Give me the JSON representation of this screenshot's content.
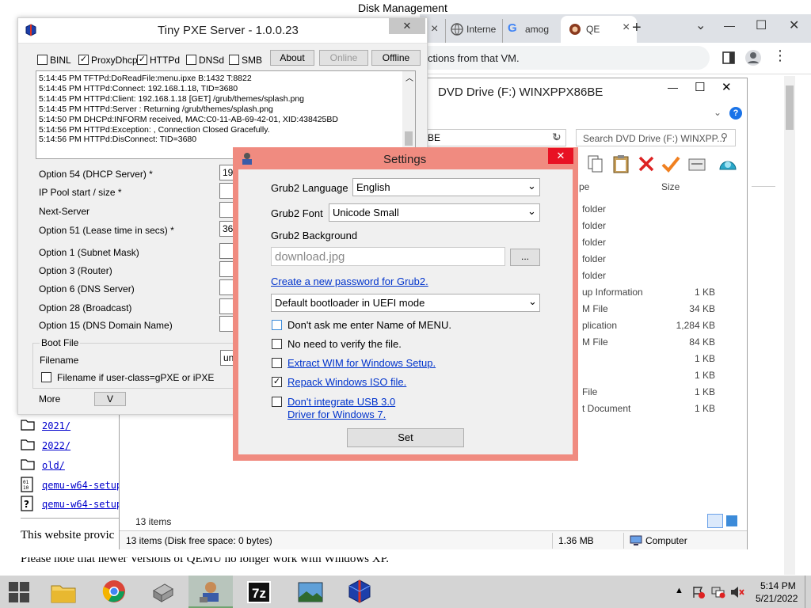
{
  "bg_title": "Disk Management",
  "chrome": {
    "tabs": [
      {
        "label": "Interne",
        "icon": "globe-icon"
      },
      {
        "label": "amog",
        "icon": "google-icon"
      },
      {
        "label": "QE",
        "icon": "qemu-icon"
      }
    ],
    "close_glyph": "×",
    "new_tab_glyph": "+",
    "menu_glyph": "⌄",
    "address_fragment": "ctions from that VM.",
    "min_glyph": "—",
    "max_glyph": "☐",
    "win_close_glyph": "✕"
  },
  "explorer": {
    "title": "DVD Drive (F:) WINXPPX86BE",
    "path_fragment": "BE",
    "search_placeholder": "Search DVD Drive (F:) WINXPP...",
    "col_type": "pe",
    "col_size": "Size",
    "rows": [
      {
        "type": "folder",
        "size": ""
      },
      {
        "type": "folder",
        "size": ""
      },
      {
        "type": "folder",
        "size": ""
      },
      {
        "type": "folder",
        "size": ""
      },
      {
        "type": "folder",
        "size": ""
      },
      {
        "type": "up Information",
        "size": "1 KB"
      },
      {
        "type": "M File",
        "size": "34 KB"
      },
      {
        "type": "plication",
        "size": "1,284 KB"
      },
      {
        "type": "M File",
        "size": "84 KB"
      },
      {
        "type": "",
        "size": "1 KB"
      },
      {
        "type": "",
        "size": "1 KB"
      },
      {
        "type": "File",
        "size": "1 KB"
      },
      {
        "type": "t Document",
        "size": "1 KB"
      }
    ],
    "items_count": "13 items",
    "status_text": "13 items (Disk free space: 0 bytes)",
    "status_size": "1.36 MB",
    "status_location": "Computer"
  },
  "web": {
    "listing": [
      {
        "name": "2021/",
        "icon": "folder-icon"
      },
      {
        "name": "2022/",
        "icon": "folder-icon"
      },
      {
        "name": "old/",
        "icon": "folder-icon"
      },
      {
        "name": "qemu-w64-setup",
        "icon": "binary-file-icon"
      },
      {
        "name": "qemu-w64-setup",
        "icon": "unknown-file-icon"
      }
    ],
    "line1": "This website provic",
    "line2": "Please note that newer Versions of QEMU no longer work with Windows XP."
  },
  "pxe": {
    "title": "Tiny PXE Server - 1.0.0.23",
    "options": [
      {
        "label": "BINL",
        "checked": false
      },
      {
        "label": "ProxyDhcp",
        "checked": true
      },
      {
        "label": "HTTPd",
        "checked": true
      },
      {
        "label": "DNSd",
        "checked": false
      },
      {
        "label": "SMB",
        "checked": false
      }
    ],
    "about_label": "About",
    "online_label": "Online",
    "offline_label": "Offline",
    "log": [
      "5:14:45 PM TFTPd:DoReadFile:menu.ipxe B:1432 T:8822",
      "5:14:45 PM HTTPd:Connect: 192.168.1.18, TID=3680",
      "5:14:45 PM HTTPd:Client: 192.168.1.18 [GET] /grub/themes/splash.png",
      "5:14:45 PM HTTPd:Server : Returning /grub/themes/splash.png",
      "5:14:50 PM DHCPd:INFORM received, MAC:C0-11-AB-69-42-01, XID:438425BD",
      "5:14:56 PM HTTPd:Exception: , Connection Closed Gracefully.",
      "5:14:56 PM HTTPd:DisConnect: TID=3680"
    ],
    "fields": [
      {
        "label": "Option 54 (DHCP Server) *",
        "value": "192"
      },
      {
        "label": "IP Pool start / size *",
        "value": ""
      },
      {
        "label": "Next-Server",
        "value": ""
      },
      {
        "label": "Option 51 (Lease time in secs) *",
        "value": "36"
      },
      {
        "label": "Option 1  (Subnet Mask)",
        "value": ""
      },
      {
        "label": "Option 3  (Router)",
        "value": ""
      },
      {
        "label": "Option 6  (DNS Server)",
        "value": ""
      },
      {
        "label": "Option 28 (Broadcast)",
        "value": ""
      },
      {
        "label": "Option 15 (DNS Domain Name)",
        "value": ""
      }
    ],
    "bootfile_group": "Boot File",
    "filename_label": "Filename",
    "filename_value": "un",
    "userclass_label": "Filename if user-class=gPXE or iPXE",
    "more_label": "More",
    "v_label": "V"
  },
  "settings": {
    "title": "Settings",
    "grub_lang_label": "Grub2 Language",
    "grub_lang_value": "English",
    "grub_font_label": "Grub2 Font",
    "grub_font_value": "Unicode Small",
    "grub_bg_label": "Grub2 Background",
    "grub_bg_value": "download.jpg",
    "browse_label": "...",
    "password_link": "Create a new password for Grub2.",
    "bootloader_value": "Default bootloader in UEFI mode",
    "checks": [
      {
        "label": "Don't ask me enter Name of MENU.",
        "checked": false,
        "link": false
      },
      {
        "label": "No need to verify the file.",
        "checked": false,
        "link": false
      },
      {
        "label": "Extract WIM for Windows Setup.",
        "checked": false,
        "link": true
      },
      {
        "label": "Repack Windows ISO file.",
        "checked": true,
        "link": true
      }
    ],
    "usb_line1": "Don't integrate USB 3.0",
    "usb_line2": "Driver for Windows 7.",
    "set_label": "Set"
  },
  "taskbar": {
    "time": "5:14 PM",
    "date": "5/21/2022",
    "apps": [
      "file-explorer-icon",
      "chrome-icon",
      "usb-tool-icon",
      "pxe-agent-icon",
      "7zip-icon",
      "image-viewer-icon",
      "pxe-server-icon"
    ]
  },
  "colors": {
    "dialog_border": "#f08b80",
    "pxe_border": "#d9d9d9",
    "taskbar": "#d4d4d4",
    "link": "#0033cc",
    "close_red": "#e81123"
  }
}
